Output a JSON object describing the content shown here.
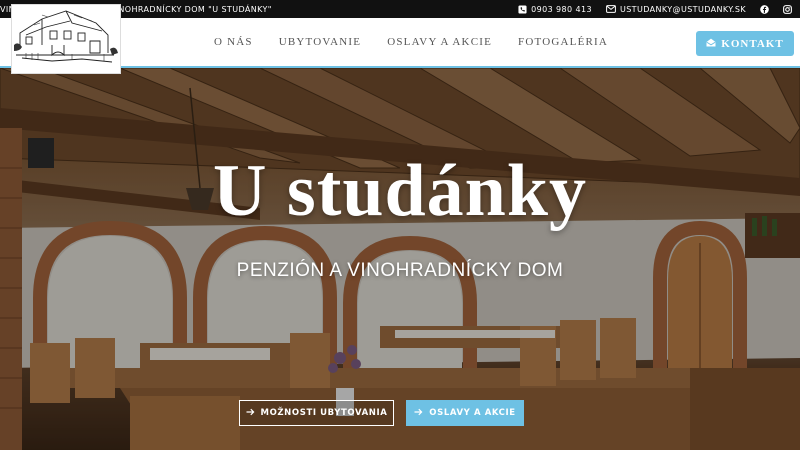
{
  "topbar": {
    "tagline": "VINÁRSTVO A PENZIÓN - VINOHRADNÍCKY DOM \"U STUDÁNKY\"",
    "phone": "0903 980 413",
    "email": "USTUDANKY@USTUDANKY.SK",
    "icons": [
      "phone-icon",
      "email-icon",
      "facebook-icon",
      "instagram-icon"
    ]
  },
  "nav": {
    "items": [
      "O NÁS",
      "UBYTOVANIE",
      "OSLAVY A AKCIE",
      "FOTOGALÉRIA"
    ],
    "kontakt_label": "KONTAKT"
  },
  "hero": {
    "title": "U studánky",
    "subtitle": "PENZIÓN A VINOHRADNÍCKY DOM",
    "buttons": [
      {
        "label": "MOŽNOSTI UBYTOVANIA",
        "icon": "arrow-right-icon"
      },
      {
        "label": "OSLAVY A AKCIE",
        "icon": "arrow-right-icon"
      }
    ]
  },
  "colors": {
    "accent": "#6ec1e4",
    "topbar": "#111111",
    "nav_text": "#555555"
  }
}
